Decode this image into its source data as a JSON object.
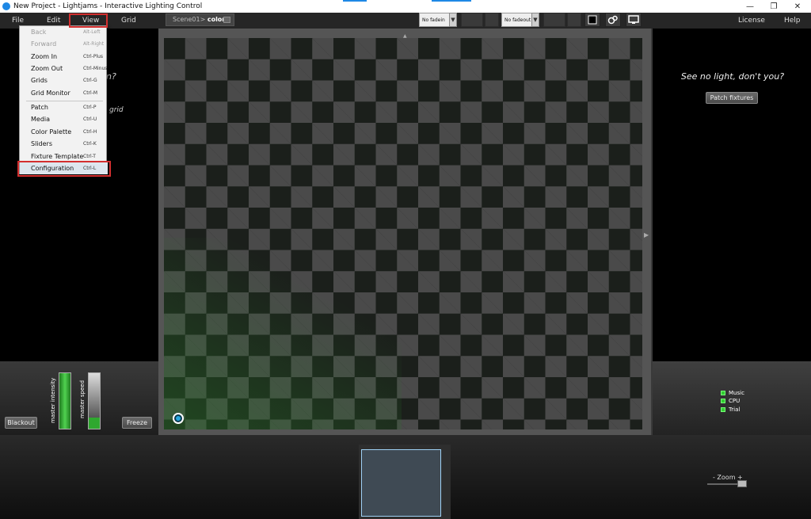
{
  "window": {
    "title": "New Project - Lightjams - Interactive Lighting Control",
    "minimize": "—",
    "restore": "❐",
    "close": "✕"
  },
  "menubar": {
    "file": "File",
    "edit": "Edit",
    "view": "View",
    "grid": "Grid",
    "license": "License",
    "help": "Help"
  },
  "scene": {
    "prefix": "Scene01>",
    "name": "color"
  },
  "toolbar": {
    "fadein": "No fadein",
    "fadeout": "No fadeout"
  },
  "view_menu": {
    "items": [
      {
        "label": "Back",
        "shortcut": "Alt-Left",
        "enabled": false
      },
      {
        "label": "Forward",
        "shortcut": "Alt-Right",
        "enabled": false
      },
      {
        "label": "Zoom In",
        "shortcut": "Ctrl-Plus",
        "enabled": true
      },
      {
        "label": "Zoom Out",
        "shortcut": "Ctrl-Minus",
        "enabled": true
      },
      {
        "label": "Grids",
        "shortcut": "Ctrl-G",
        "enabled": true
      },
      {
        "label": "Grid Monitor",
        "shortcut": "Ctrl-M",
        "enabled": true
      },
      {
        "label": "Patch",
        "shortcut": "Ctrl-P",
        "enabled": true
      },
      {
        "label": "Media",
        "shortcut": "Ctrl-U",
        "enabled": true
      },
      {
        "label": "Color Palette",
        "shortcut": "Ctrl-H",
        "enabled": true
      },
      {
        "label": "Sliders",
        "shortcut": "Ctrl-K",
        "enabled": true
      },
      {
        "label": "Fixture Template",
        "shortcut": "Ctrl-T",
        "enabled": true
      },
      {
        "label": "Configuration",
        "shortcut": "Ctrl-L",
        "enabled": true
      }
    ]
  },
  "left_panel": {
    "ghost_text_1": "n?",
    "ghost_text_2": "grid"
  },
  "right_panel": {
    "message": "See no light, don't you?",
    "patch_button": "Patch fixtures",
    "status": [
      "Music",
      "CPU",
      "Trial"
    ]
  },
  "controls": {
    "blackout": "Blackout",
    "freeze": "Freeze",
    "master_intensity": "master intensity",
    "master_speed": "master speed",
    "master_intensity_level": 1.0,
    "master_speed_level": 0.2,
    "zoom_label": "- Zoom +"
  },
  "colors": {
    "accent": "#1e88e5",
    "highlight": "#d32f2f",
    "slider_green": "#2fa82f",
    "led_green": "#33cc33"
  }
}
